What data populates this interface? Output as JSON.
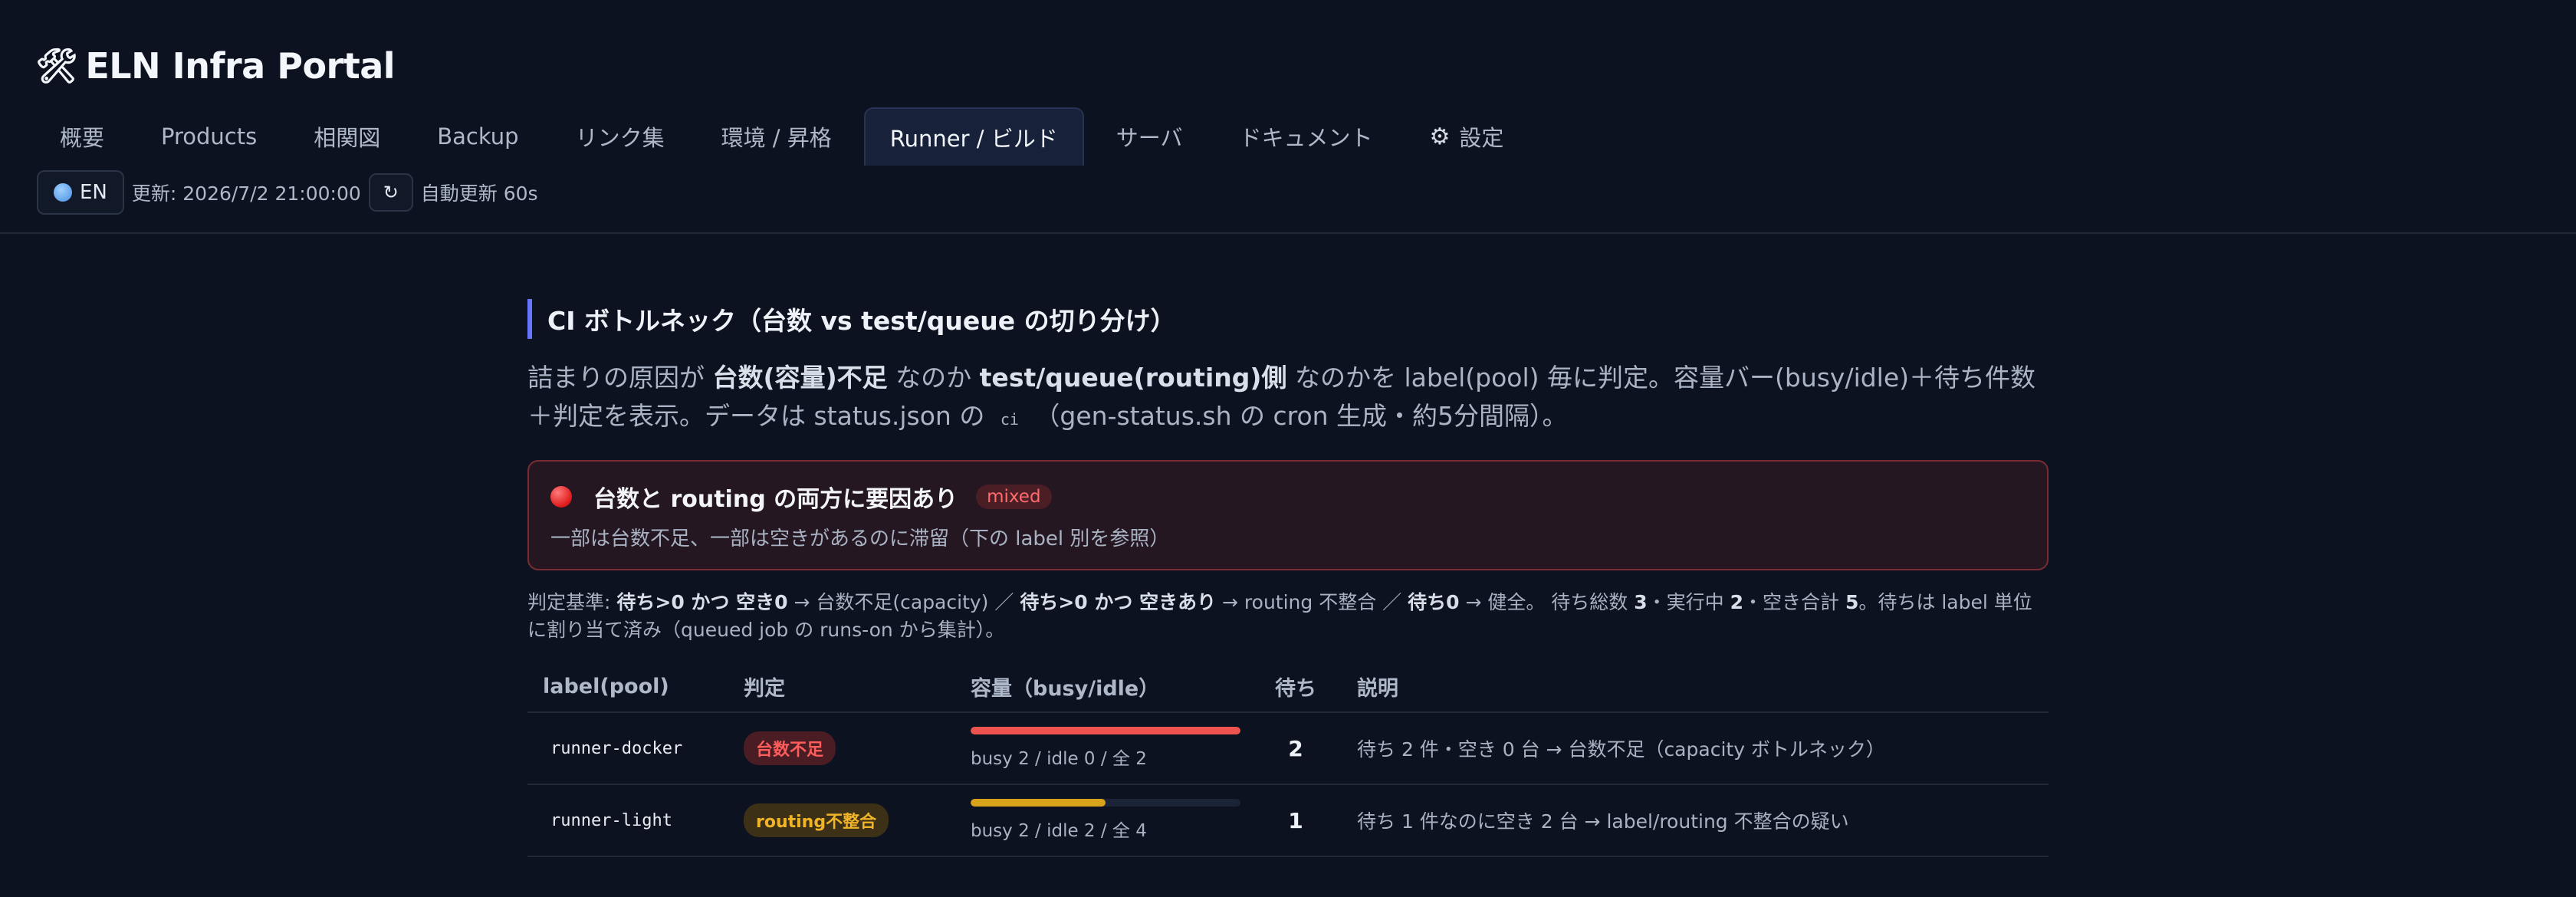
{
  "app": {
    "title": "ELN Infra Portal",
    "icon": "tools-icon"
  },
  "tabs": [
    {
      "label": "概要"
    },
    {
      "label": "Products"
    },
    {
      "label": "相関図"
    },
    {
      "label": "Backup"
    },
    {
      "label": "リンク集"
    },
    {
      "label": "環境 / 昇格"
    },
    {
      "label": "Runner / ビルド",
      "active": true
    },
    {
      "label": "サーバ"
    },
    {
      "label": "ドキュメント"
    },
    {
      "label": "設定",
      "icon": "gear-icon"
    }
  ],
  "toolbar": {
    "lang_label": "EN",
    "updated": "更新: 2026/7/2 21:00:00",
    "refresh_icon": "↻",
    "auto_refresh": "自動更新 60s"
  },
  "section": {
    "title": "CI ボトルネック（台数 vs test/queue の切り分け）",
    "desc_1": "詰まりの原因が ",
    "desc_b1": "台数(容量)不足",
    "desc_2": " なのか ",
    "desc_b2": "test/queue(routing)側",
    "desc_3": " なのかを label(pool) 毎に判定。容量バー(busy/idle)＋待ち件数＋判定を表示。データは status.json の ",
    "desc_code": "ci",
    "desc_4": " （gen-status.sh の cron 生成・約5分間隔）。"
  },
  "alert": {
    "title": "台数と routing の両方に要因あり",
    "pill": "mixed",
    "sub": "一部は台数不足、一部は空きがあるのに滞留（下の label 別を参照）",
    "color": "#e02020"
  },
  "criteria": {
    "prefix": "判定基準: ",
    "b1": "待ち>0 かつ 空き0",
    "t1": " → 台数不足(capacity) ／ ",
    "b2": "待ち>0 かつ 空きあり",
    "t2": " → routing 不整合 ／ ",
    "b3": "待ち0",
    "t3": " → 健全。 待ち総数 ",
    "n1": "3",
    "t4": "・実行中 ",
    "n2": "2",
    "t5": "・空き合計 ",
    "n3": "5",
    "t6": "。待ちは label 単位に割り当て済み（queued job の runs-on から集計）。"
  },
  "table": {
    "headers": [
      "label(pool)",
      "判定",
      "容量（busy/idle）",
      "待ち",
      "説明"
    ],
    "rows": [
      {
        "label": "runner-docker",
        "verdict": "台数不足",
        "verdict_kind": "cap",
        "busy_fraction": 1.0,
        "bar_color": "#ef5350",
        "capacity": "busy 2 / idle 0 / 全 2",
        "queued": "2",
        "note": "待ち 2 件・空き 0 台 → 台数不足（capacity ボトルネック）"
      },
      {
        "label": "runner-light",
        "verdict": "routing不整合",
        "verdict_kind": "rout",
        "busy_fraction": 0.5,
        "bar_color": "#d9a21b",
        "capacity": "busy 2 / idle 2 / 全 4",
        "queued": "1",
        "note": "待ち 1 件なのに空き 2 台 → label/routing 不整合の疑い"
      }
    ]
  }
}
